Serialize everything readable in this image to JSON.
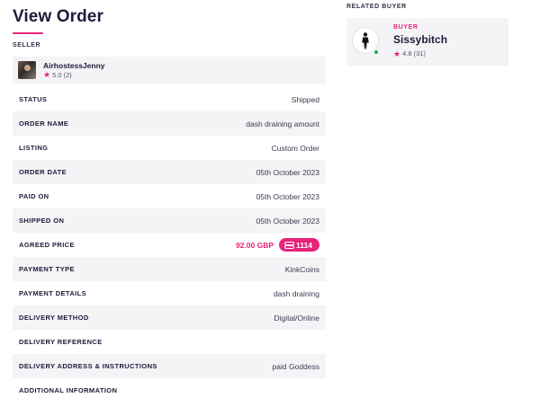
{
  "page": {
    "title": "View Order"
  },
  "seller": {
    "section_label": "SELLER",
    "name": "AirhostessJenny",
    "rating": "5.0 (2)"
  },
  "details": {
    "status": {
      "label": "STATUS",
      "value": "Shipped"
    },
    "order_name": {
      "label": "ORDER NAME",
      "value": "dash draining amount"
    },
    "listing": {
      "label": "LISTING",
      "value": "Custom Order"
    },
    "order_date": {
      "label": "ORDER DATE",
      "value": "05th October 2023"
    },
    "paid_on": {
      "label": "PAID ON",
      "value": "05th October 2023"
    },
    "shipped_on": {
      "label": "SHIPPED ON",
      "value": "05th October 2023"
    },
    "agreed_price": {
      "label": "AGREED PRICE",
      "gbp": "92.00 GBP",
      "coins": "1114"
    },
    "payment_type": {
      "label": "PAYMENT TYPE",
      "value": "KinkCoins"
    },
    "payment_details": {
      "label": "PAYMENT DETAILS",
      "value": "dash draining"
    },
    "delivery_method": {
      "label": "DELIVERY METHOD",
      "value": "Digital/Online"
    },
    "delivery_reference": {
      "label": "DELIVERY REFERENCE",
      "value": ""
    },
    "delivery_address": {
      "label": "DELIVERY ADDRESS & INSTRUCTIONS",
      "value": "paid Goddess"
    },
    "additional_info": {
      "label": "ADDITIONAL INFORMATION",
      "value": ""
    }
  },
  "buyer": {
    "section_label": "RELATED BUYER",
    "role": "BUYER",
    "name": "Sissybitch",
    "rating": "4.8 (31)"
  },
  "colors": {
    "accent": "#e8227a",
    "row_shade": "#f4f4f7",
    "online": "#1fa34a"
  },
  "icons": {
    "rating": "star-icon",
    "coin": "coin-icon",
    "buyer_avatar": "person-silhouette-icon"
  }
}
